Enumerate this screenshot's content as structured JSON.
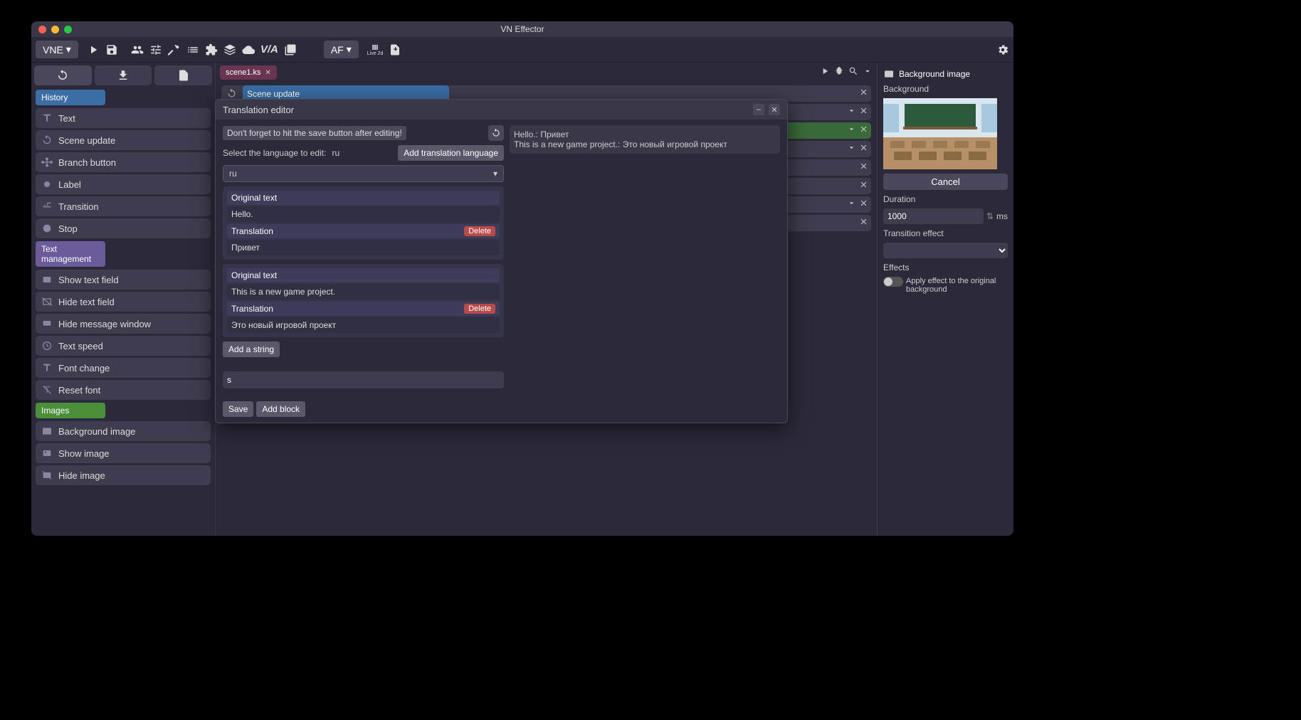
{
  "window": {
    "title": "VN Effector"
  },
  "toolbar": {
    "vne_label": "VNE",
    "af_label": "AF",
    "live2d_label": "Live 2d"
  },
  "tabs": {
    "scene1": "scene1.ks"
  },
  "timeline": {
    "scene_update": "Scene update"
  },
  "sidebar": {
    "sections": {
      "history": "History",
      "text_mgmt": "Text management",
      "images": "Images"
    },
    "history_items": [
      "Text",
      "Scene update",
      "Branch button",
      "Label",
      "Transition",
      "Stop"
    ],
    "text_items": [
      "Show text field",
      "Hide text field",
      "Hide message window",
      "Text speed",
      "Font change",
      "Reset font"
    ],
    "image_items": [
      "Background image",
      "Show image",
      "Hide image"
    ]
  },
  "dialog": {
    "title": "Translation editor",
    "hint": "Don't forget to hit the save button after editing!",
    "select_label": "Select the language to edit:",
    "current_lang": "ru",
    "add_lang_btn": "Add translation language",
    "lang_dropdown": "ru",
    "blocks": [
      {
        "original_label": "Original text",
        "original": "Hello.",
        "translation_label": "Translation",
        "translation": "Привет",
        "delete": "Delete"
      },
      {
        "original_label": "Original text",
        "original": "This is a new game project.",
        "translation_label": "Translation",
        "translation": "Это новый игровой проект",
        "delete": "Delete"
      }
    ],
    "add_string": "Add a string",
    "block_input": "s",
    "save": "Save",
    "add_block": "Add block",
    "preview": [
      "Hello.: Привет",
      "This is a new game project.: Это новый игровой проект"
    ]
  },
  "rightpanel": {
    "title": "Background image",
    "bg_label": "Background",
    "cancel": "Cancel",
    "duration_label": "Duration",
    "duration_value": "1000",
    "duration_unit": "ms",
    "transition_label": "Transition effect",
    "effects_label": "Effects",
    "apply_effect": "Apply effect to the original background"
  }
}
